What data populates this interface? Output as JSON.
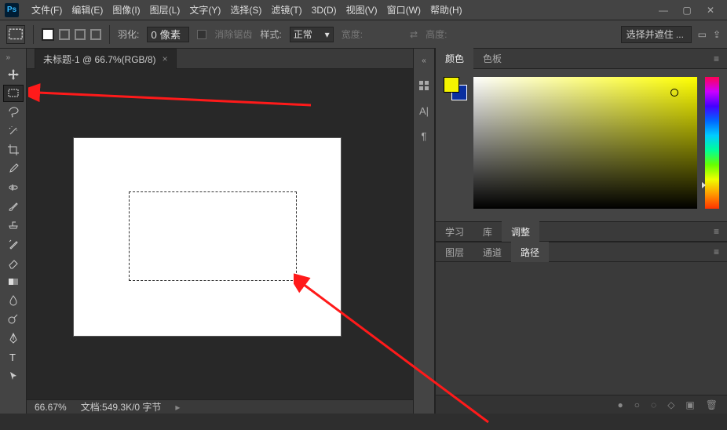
{
  "app": {
    "logo": "Ps"
  },
  "menu": {
    "file": "文件(F)",
    "edit": "编辑(E)",
    "image": "图像(I)",
    "layer": "图层(L)",
    "type": "文字(Y)",
    "select": "选择(S)",
    "filter": "滤镜(T)",
    "threeD": "3D(D)",
    "view": "视图(V)",
    "window": "窗口(W)",
    "help": "帮助(H)"
  },
  "options": {
    "feather_label": "羽化:",
    "feather_value": "0 像素",
    "antialias": "消除锯齿",
    "style_label": "样式:",
    "style_value": "正常",
    "width_label": "宽度:",
    "height_label": "高度:",
    "mask": "选择并遮住 ..."
  },
  "document": {
    "tab_title": "未标题-1 @ 66.7%(RGB/8)",
    "zoom": "66.67%",
    "status": "文档:549.3K/0 字节"
  },
  "panel_tabs": {
    "color": "颜色",
    "swatches": "色板"
  },
  "panel_tabs2": {
    "learn": "学习",
    "libraries": "库",
    "adjust": "调整"
  },
  "panel_tabs3": {
    "layers": "图层",
    "channels": "通道",
    "paths": "路径"
  }
}
